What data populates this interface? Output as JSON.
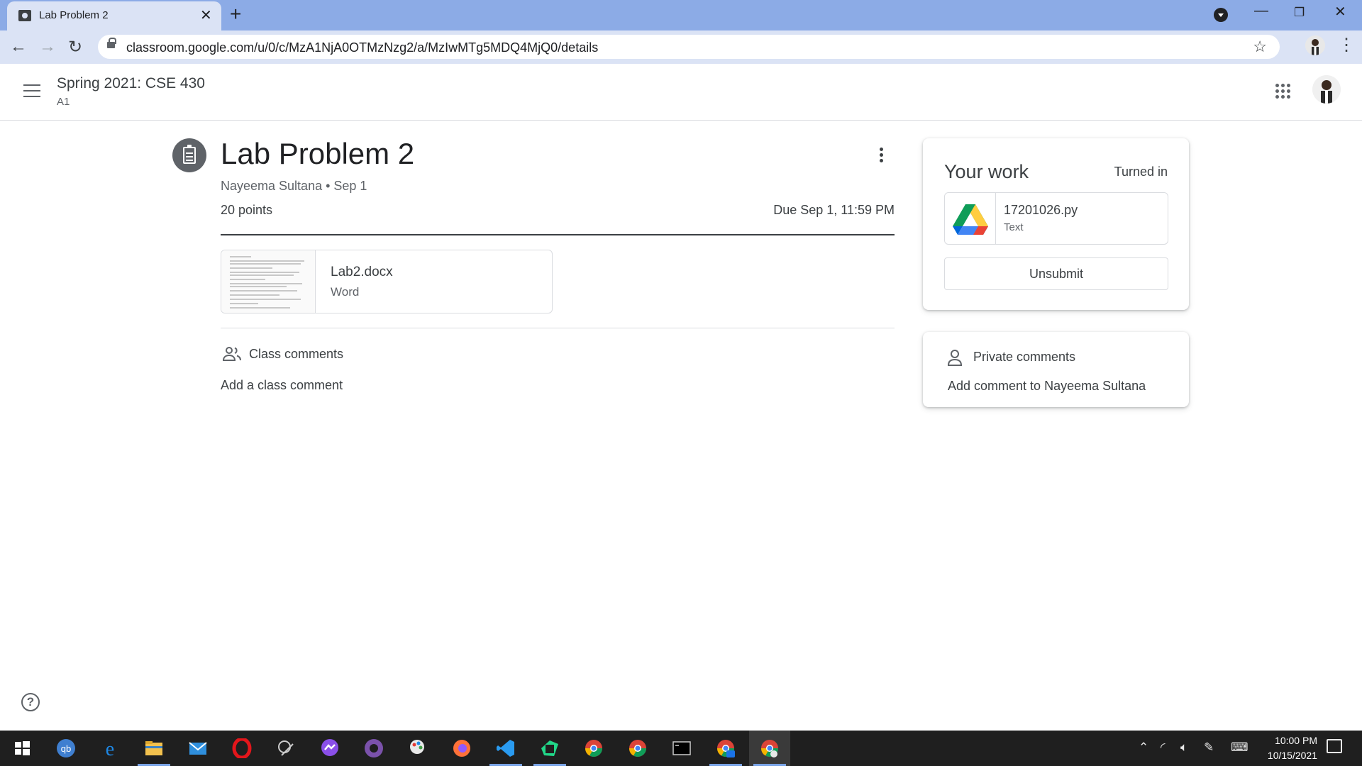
{
  "browser": {
    "tab_title": "Lab Problem 2",
    "url": "classroom.google.com/u/0/c/MzA1NjA0OTMzNzg2/a/MzIwMTg5MDQ4MjQ0/details"
  },
  "header": {
    "class_name": "Spring 2021: CSE 430",
    "section": "A1"
  },
  "assignment": {
    "title": "Lab Problem 2",
    "author_date": "Nayeema Sultana • Sep 1",
    "points": "20 points",
    "due": "Due Sep 1, 11:59 PM",
    "attachment": {
      "name": "Lab2.docx",
      "type": "Word"
    }
  },
  "class_comments": {
    "heading": "Class comments",
    "add_label": "Add a class comment"
  },
  "your_work": {
    "title": "Your work",
    "status": "Turned in",
    "file": {
      "name": "17201026.py",
      "type": "Text"
    },
    "unsubmit_label": "Unsubmit"
  },
  "private_comments": {
    "heading": "Private comments",
    "add_label": "Add comment to Nayeema Sultana"
  },
  "taskbar": {
    "time": "10:00 PM",
    "date": "10/15/2021",
    "apps": [
      "start",
      "qbittorrent",
      "edge",
      "file-explorer",
      "mail",
      "opera",
      "inkscape",
      "messenger",
      "github-desktop",
      "paint",
      "firefox",
      "vscode",
      "pycharm",
      "chrome-profile-1",
      "chrome",
      "terminal",
      "chrome-profile-ek",
      "chrome-current"
    ]
  }
}
